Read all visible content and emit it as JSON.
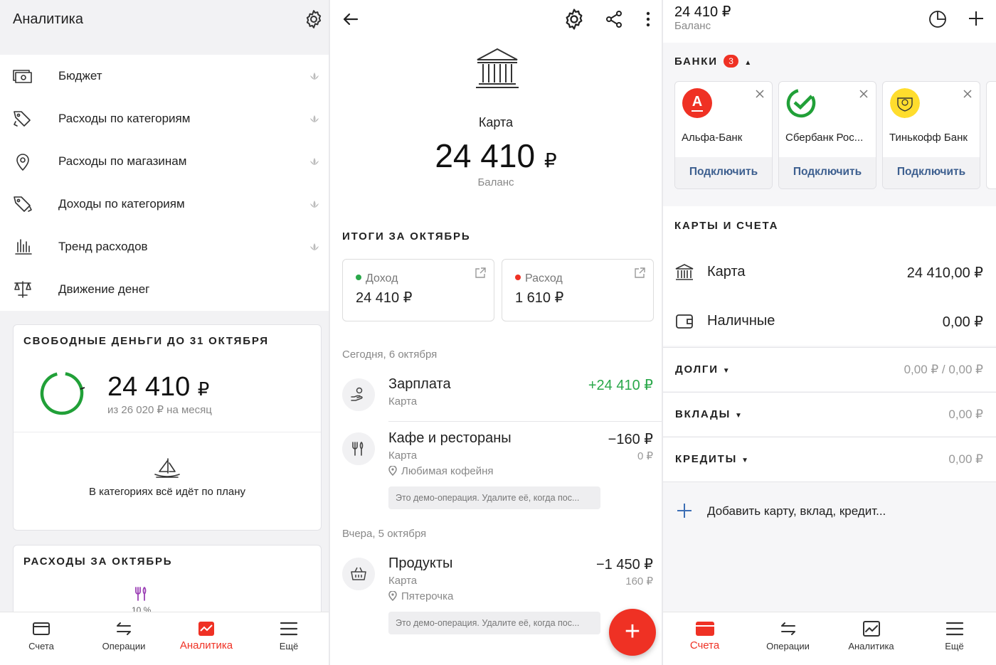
{
  "analytics": {
    "title": "Аналитика",
    "menu": [
      {
        "label": "Бюджет",
        "icon": "budget-icon"
      },
      {
        "label": "Расходы по категориям",
        "icon": "tag-out-icon"
      },
      {
        "label": "Расходы по магазинам",
        "icon": "location-pin-icon"
      },
      {
        "label": "Доходы по категориям",
        "icon": "tag-in-icon"
      },
      {
        "label": "Тренд расходов",
        "icon": "bar-chart-icon"
      },
      {
        "label": "Движение денег",
        "icon": "scales-icon"
      }
    ],
    "free_money": {
      "title": "СВОБОДНЫЕ ДЕНЬГИ ДО 31 ОКТЯБРЯ",
      "amount": "24 410",
      "currency": "₽",
      "subtitle": "из 26 020 ₽ на месяц",
      "plan_text": "В категориях всё идёт по плану"
    },
    "expenses": {
      "title": "РАСХОДЫ ЗА ОКТЯБРЬ",
      "percent": "10 %"
    },
    "nav": [
      {
        "label": "Счета",
        "icon": "card-icon",
        "active": false
      },
      {
        "label": "Операции",
        "icon": "transfer-arrows-icon",
        "active": false
      },
      {
        "label": "Аналитика",
        "icon": "analytics-icon",
        "active": true
      },
      {
        "label": "Ещё",
        "icon": "menu-icon",
        "active": false
      }
    ]
  },
  "account": {
    "name": "Карта",
    "balance": "24 410",
    "currency": "₽",
    "balance_label": "Баланс",
    "summary_title": "ИТОГИ ЗА ОКТЯБРЬ",
    "income": {
      "label": "Доход",
      "value": "24 410 ₽"
    },
    "expense": {
      "label": "Расход",
      "value": "1 610 ₽"
    },
    "groups": [
      {
        "date": "Сегодня, 6 октября"
      },
      {
        "date": "Вчера, 5 октября"
      }
    ],
    "transactions": [
      {
        "name": "Зарплата",
        "account": "Карта",
        "amount": "+24 410 ₽",
        "positive": true
      },
      {
        "name": "Кафе и рестораны",
        "account": "Карта",
        "amount": "−160 ₽",
        "sub": "0 ₽",
        "place": "Любимая кофейня",
        "note": "Это демо-операция. Удалите её, когда пос..."
      },
      {
        "name": "Продукты",
        "account": "Карта",
        "amount": "−1 450 ₽",
        "sub": "160 ₽",
        "place": "Пятерочка",
        "note": "Это демо-операция. Удалите её, когда пос..."
      }
    ],
    "fab_label": "+"
  },
  "accounts": {
    "total": "24 410 ₽",
    "total_label": "Баланс",
    "banks_title": "БАНКИ",
    "banks_badge": "3",
    "banks": [
      {
        "name": "Альфа-Банк",
        "action": "Подключить",
        "color": "#ef3124",
        "logo_text": "A"
      },
      {
        "name": "Сбербанк Рос...",
        "action": "Подключить",
        "color": "#21a038"
      },
      {
        "name": "Тинькофф Банк",
        "action": "Подключить",
        "color": "#ffdd2d"
      }
    ],
    "cards_title": "КАРТЫ И СЧЕТА",
    "items": [
      {
        "name": "Карта",
        "value": "24 410,00 ₽"
      },
      {
        "name": "Наличные",
        "value": "0,00 ₽"
      }
    ],
    "debts": {
      "label": "ДОЛГИ",
      "value": "0,00 ₽ / 0,00 ₽"
    },
    "deposits": {
      "label": "ВКЛАДЫ",
      "value": "0,00 ₽"
    },
    "credits": {
      "label": "КРЕДИТЫ",
      "value": "0,00 ₽"
    },
    "add_label": "Добавить карту, вклад, кредит...",
    "nav": [
      {
        "label": "Счета",
        "icon": "card-icon",
        "active": true
      },
      {
        "label": "Операции",
        "icon": "transfer-arrows-icon",
        "active": false
      },
      {
        "label": "Аналитика",
        "icon": "analytics-icon",
        "active": false
      },
      {
        "label": "Ещё",
        "icon": "menu-icon",
        "active": false
      }
    ]
  },
  "colors": {
    "accent": "#ef3124",
    "income": "#2aa84a",
    "link": "#3d5f8f",
    "ring": "#21a038"
  }
}
